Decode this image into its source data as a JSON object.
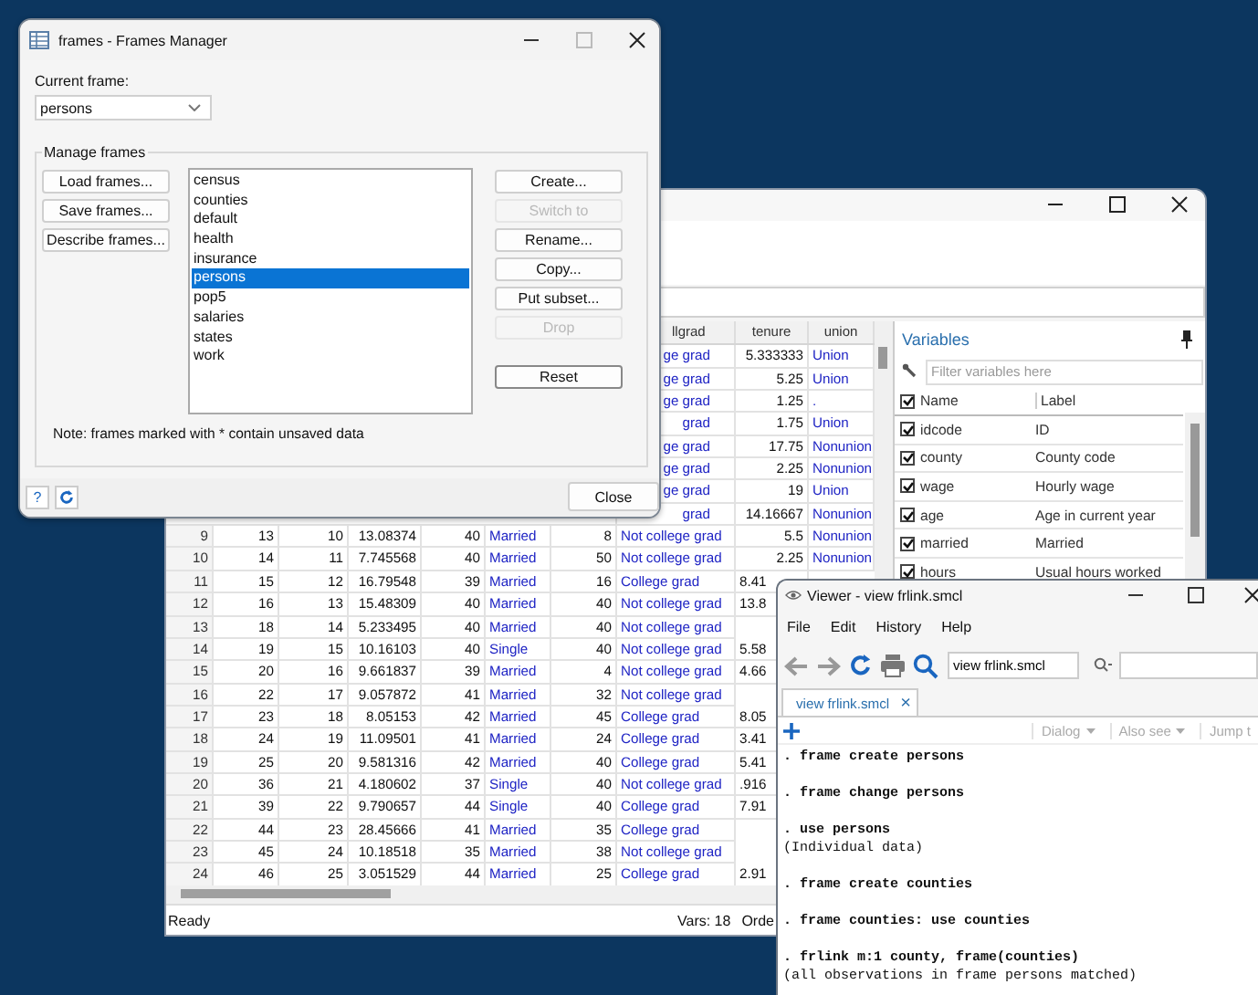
{
  "frames_dialog": {
    "title": "frames - Frames Manager",
    "current_frame_label": "Current frame:",
    "current_frame": "persons",
    "group_label": "Manage frames",
    "left_buttons": [
      {
        "label": "Load frames..."
      },
      {
        "label": "Save frames..."
      },
      {
        "label": "Describe frames..."
      }
    ],
    "frames": [
      {
        "name": "census",
        "selected": false
      },
      {
        "name": "counties",
        "selected": false
      },
      {
        "name": "default",
        "selected": false
      },
      {
        "name": "health",
        "selected": false
      },
      {
        "name": "insurance",
        "selected": false
      },
      {
        "name": "persons",
        "selected": true
      },
      {
        "name": "pop5",
        "selected": false
      },
      {
        "name": "salaries",
        "selected": false
      },
      {
        "name": "states",
        "selected": false
      },
      {
        "name": "work",
        "selected": false
      }
    ],
    "right_buttons": [
      {
        "label": "Create...",
        "disabled": false
      },
      {
        "label": "Switch to",
        "disabled": true
      },
      {
        "label": "Rename...",
        "disabled": false
      },
      {
        "label": "Copy...",
        "disabled": false
      },
      {
        "label": "Put subset...",
        "disabled": false
      },
      {
        "label": "Drop",
        "disabled": true
      }
    ],
    "reset_button": "Reset",
    "note": "Note: frames marked with * contain unsaved data",
    "help_button": "?",
    "close_button": "Close"
  },
  "data_editor": {
    "header": [
      "llgrad",
      "tenure",
      "union"
    ],
    "rows": [
      {
        "cells": [
          "ge grad",
          "5.333333",
          "Union"
        ]
      },
      {
        "cells": [
          "ge grad",
          "5.25",
          "Union"
        ]
      },
      {
        "cells": [
          "ge grad",
          "1.25",
          "."
        ]
      },
      {
        "cells": [
          "grad",
          "1.75",
          "Union"
        ]
      },
      {
        "cells": [
          "ge grad",
          "17.75",
          "Nonunion"
        ]
      },
      {
        "cells": [
          "ge grad",
          "2.25",
          "Nonunion"
        ]
      },
      {
        "cells": [
          "ge grad",
          "19",
          "Union"
        ]
      },
      {
        "cells": [
          "grad",
          "14.16667",
          "Nonunion"
        ]
      },
      {
        "cells": [
          "9",
          "13",
          "10",
          "13.08374",
          "40",
          "Married",
          "8",
          "Not college grad",
          "5.5",
          "Nonunion"
        ]
      },
      {
        "cells": [
          "10",
          "14",
          "11",
          "7.745568",
          "40",
          "Married",
          "50",
          "Not college grad",
          "2.25",
          "Nonunion"
        ]
      },
      {
        "cells": [
          "11",
          "15",
          "12",
          "16.79548",
          "39",
          "Married",
          "16",
          "College grad",
          "8.41"
        ]
      },
      {
        "cells": [
          "12",
          "16",
          "13",
          "15.48309",
          "40",
          "Married",
          "40",
          "Not college grad",
          "13.8"
        ]
      },
      {
        "cells": [
          "13",
          "18",
          "14",
          "5.233495",
          "40",
          "Married",
          "40",
          "Not college grad"
        ]
      },
      {
        "cells": [
          "14",
          "19",
          "15",
          "10.16103",
          "40",
          "Single",
          "40",
          "Not college grad",
          "5.58"
        ]
      },
      {
        "cells": [
          "15",
          "20",
          "16",
          "9.661837",
          "39",
          "Married",
          "4",
          "Not college grad",
          "4.66"
        ]
      },
      {
        "cells": [
          "16",
          "22",
          "17",
          "9.057872",
          "41",
          "Married",
          "32",
          "Not college grad"
        ]
      },
      {
        "cells": [
          "17",
          "23",
          "18",
          "8.05153",
          "42",
          "Married",
          "45",
          "College grad",
          "8.05"
        ]
      },
      {
        "cells": [
          "18",
          "24",
          "19",
          "11.09501",
          "41",
          "Married",
          "24",
          "College grad",
          "3.41"
        ]
      },
      {
        "cells": [
          "19",
          "25",
          "20",
          "9.581316",
          "42",
          "Married",
          "40",
          "College grad",
          "5.41"
        ]
      },
      {
        "cells": [
          "20",
          "36",
          "21",
          "4.180602",
          "37",
          "Single",
          "40",
          "Not college grad",
          ".916"
        ]
      },
      {
        "cells": [
          "21",
          "39",
          "22",
          "9.790657",
          "44",
          "Single",
          "40",
          "College grad",
          "7.91"
        ]
      },
      {
        "cells": [
          "22",
          "44",
          "23",
          "28.45666",
          "41",
          "Married",
          "35",
          "College grad"
        ]
      },
      {
        "cells": [
          "23",
          "45",
          "24",
          "10.18518",
          "35",
          "Married",
          "38",
          "Not college grad"
        ]
      },
      {
        "cells": [
          "24",
          "46",
          "25",
          "3.051529",
          "44",
          "Married",
          "25",
          "College grad",
          "2.91"
        ]
      }
    ],
    "variables": {
      "title": "Variables",
      "filter_placeholder": "Filter variables here",
      "columns": [
        "Name",
        "Label"
      ],
      "all_checked": true,
      "items": [
        {
          "name": "idcode",
          "label": "ID",
          "checked": true
        },
        {
          "name": "county",
          "label": "County code",
          "checked": true
        },
        {
          "name": "wage",
          "label": "Hourly wage",
          "checked": true
        },
        {
          "name": "age",
          "label": "Age in current year",
          "checked": true
        },
        {
          "name": "married",
          "label": "Married",
          "checked": true
        },
        {
          "name": "hours",
          "label": "Usual hours worked",
          "checked": true
        }
      ]
    },
    "status_bar": {
      "ready": "Ready",
      "vars": "Vars: 18",
      "order": "Orde"
    }
  },
  "viewer": {
    "title": "Viewer - view frlink.smcl",
    "menu": [
      "File",
      "Edit",
      "History",
      "Help"
    ],
    "address": "view frlink.smcl",
    "tab": {
      "label": "view frlink.smcl",
      "close": "×"
    },
    "actions": [
      {
        "label": "Dialog",
        "menu": true
      },
      {
        "label": "Also see",
        "menu": true
      },
      {
        "label": "Jump t",
        "menu": false
      }
    ],
    "blocks": [
      [
        {
          "kind": "command",
          "text": ". frame create persons"
        }
      ],
      [
        {
          "kind": "command",
          "text": ". frame change persons"
        }
      ],
      [
        {
          "kind": "command",
          "text": ". use persons"
        },
        {
          "kind": "result",
          "text": "(Individual data)"
        }
      ],
      [
        {
          "kind": "command",
          "text": ". frame create counties"
        }
      ],
      [
        {
          "kind": "command",
          "text": ". frame counties: use counties"
        }
      ],
      [
        {
          "kind": "command",
          "text": ". frlink m:1 county, frame(counties)"
        },
        {
          "kind": "result",
          "text": "(all observations in frame persons matched)"
        }
      ]
    ]
  }
}
